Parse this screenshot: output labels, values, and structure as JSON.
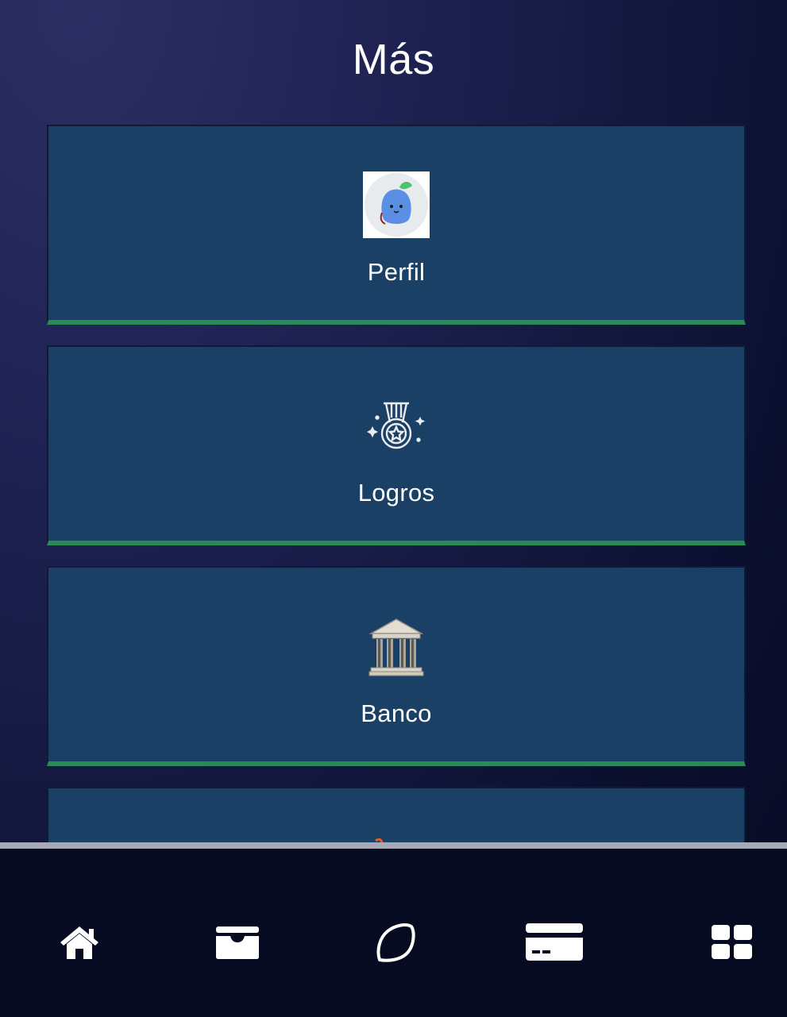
{
  "header": {
    "title": "Más"
  },
  "menu": {
    "items": [
      {
        "label": "Perfil",
        "icon": "profile-avatar-icon"
      },
      {
        "label": "Logros",
        "icon": "medal-icon"
      },
      {
        "label": "Banco",
        "icon": "bank-icon"
      },
      {
        "label": "",
        "icon": "partially-visible-icon"
      }
    ]
  },
  "bottom_nav": {
    "items": [
      {
        "icon": "home-icon"
      },
      {
        "icon": "wallet-icon"
      },
      {
        "icon": "leaf-icon"
      },
      {
        "icon": "credit-card-icon"
      },
      {
        "icon": "grid-icon"
      }
    ]
  },
  "colors": {
    "card_bg": "#1b4066",
    "card_accent": "#2a8a55",
    "nav_bg": "#070b22"
  }
}
